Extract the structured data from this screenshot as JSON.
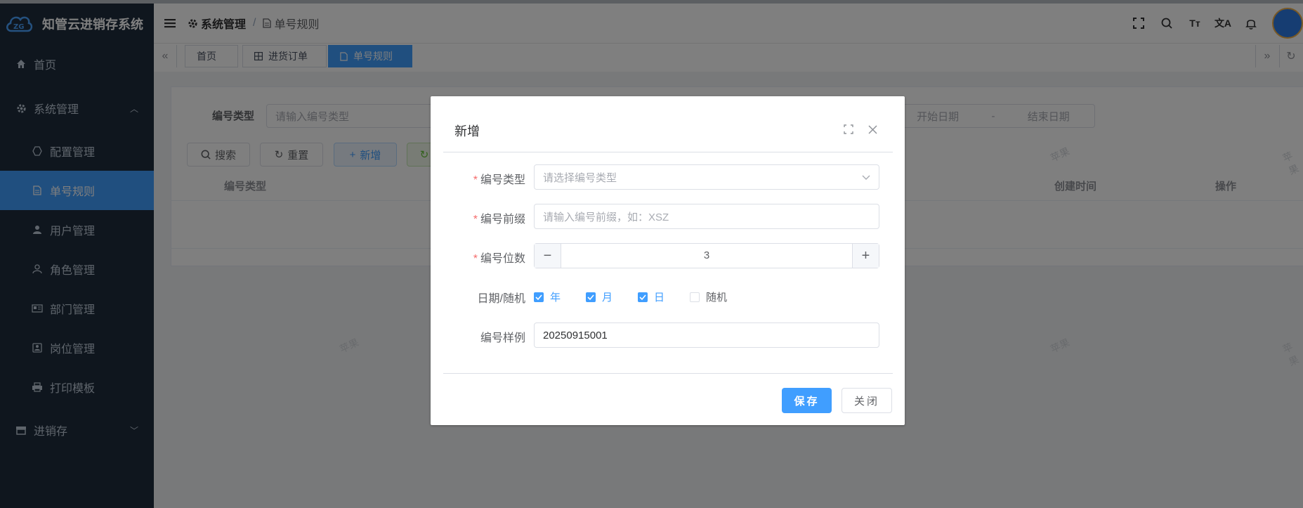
{
  "app": {
    "title": "知管云进销存系统"
  },
  "sidebar": {
    "items": [
      {
        "label": "首页",
        "icon": "home-icon"
      },
      {
        "label": "系统管理",
        "icon": "gear-icon"
      },
      {
        "label": "配置管理",
        "icon": "hexagon-icon"
      },
      {
        "label": "单号规则",
        "icon": "document-icon"
      },
      {
        "label": "用户管理",
        "icon": "user-icon"
      },
      {
        "label": "角色管理",
        "icon": "user-outline-icon"
      },
      {
        "label": "部门管理",
        "icon": "id-card-icon"
      },
      {
        "label": "岗位管理",
        "icon": "badge-icon"
      },
      {
        "label": "打印模板",
        "icon": "printer-icon"
      },
      {
        "label": "进销存",
        "icon": "store-icon"
      }
    ]
  },
  "breadcrumb": {
    "parent": "系统管理",
    "current": "单号规则"
  },
  "tags": [
    {
      "label": "首页"
    },
    {
      "label": "进货订单"
    },
    {
      "label": "单号规则"
    }
  ],
  "search": {
    "type_label": "编号类型",
    "type_placeholder": "请输入编号类型",
    "start_date": "开始日期",
    "date_sep": "-",
    "end_date": "结束日期",
    "search_btn": "搜索",
    "reset_btn": "重置",
    "add_btn": "新增"
  },
  "table": {
    "columns": [
      "编号类型",
      "创建时间",
      "操作"
    ]
  },
  "watermark": "苹果",
  "dialog": {
    "title": "新增",
    "type": {
      "label": "编号类型",
      "placeholder": "请选择编号类型"
    },
    "prefix": {
      "label": "编号前缀",
      "placeholder": "请输入编号前缀，如：XSZ"
    },
    "digits": {
      "label": "编号位数",
      "value": "3"
    },
    "date_random": {
      "label": "日期/随机",
      "options": [
        {
          "label": "年",
          "checked": true
        },
        {
          "label": "月",
          "checked": true
        },
        {
          "label": "日",
          "checked": true
        },
        {
          "label": "随机",
          "checked": false
        }
      ]
    },
    "sample": {
      "label": "编号样例",
      "value": "20250915001"
    },
    "save_btn": "保存",
    "close_btn": "关闭"
  },
  "colors": {
    "primary": "#409eff",
    "sidebar": "#1f2d3d",
    "required": "#f56c6c"
  }
}
